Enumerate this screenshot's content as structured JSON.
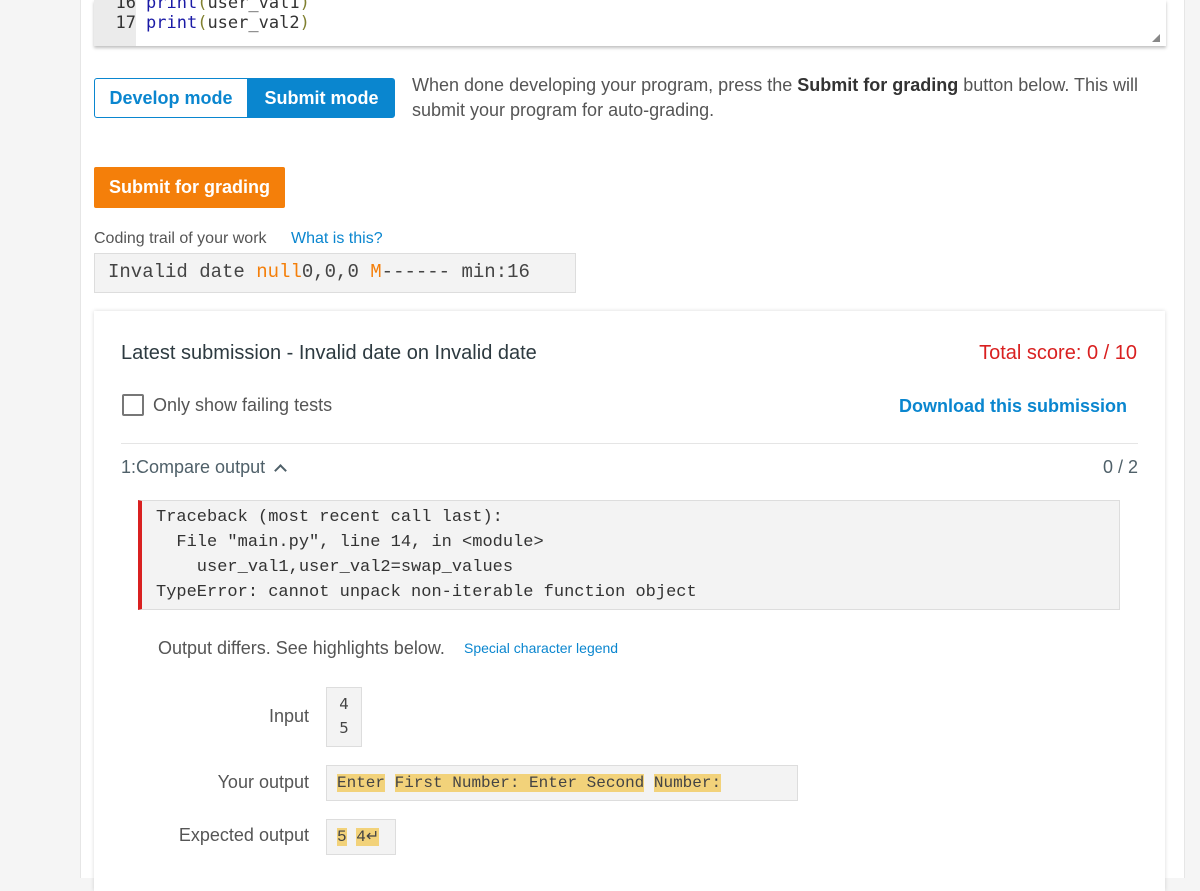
{
  "editor": {
    "lines": [
      {
        "num": "16",
        "fn": "print",
        "arg": "user_val1"
      },
      {
        "num": "17",
        "fn": "print",
        "arg": "user_val2"
      }
    ]
  },
  "modes": {
    "develop": "Develop mode",
    "submit": "Submit mode",
    "desc_before": "When done developing your program, press the ",
    "desc_bold": "Submit for grading",
    "desc_after": " button below. This will submit your program for auto-grading."
  },
  "submit_button": "Submit for grading",
  "trail": {
    "label": "Coding trail of your work",
    "link": "What is this?",
    "prefix": "Invalid date ",
    "null": "null",
    "nums": "0,0,0 ",
    "m": "M",
    "dashes": "------ min:16"
  },
  "submission": {
    "title": "Latest submission - Invalid date on Invalid date",
    "total": "Total score: 0 / 10",
    "only_failing": "Only show failing tests",
    "download": "Download this submission",
    "test": {
      "title": "1:Compare output",
      "score": "0 / 2",
      "traceback": "Traceback (most recent call last):\n  File \"main.py\", line 14, in <module>\n    user_val1,user_val2=swap_values\nTypeError: cannot unpack non-iterable function object",
      "differs": "Output differs. See highlights below.",
      "legend": "Special character legend",
      "input_label": "Input",
      "input": [
        "4",
        "5"
      ],
      "your_label": "Your output",
      "your_output": [
        "Enter",
        "First Number: Enter Second",
        "Number:"
      ],
      "expected_label": "Expected output",
      "expected": [
        "5",
        "4↵"
      ]
    }
  }
}
